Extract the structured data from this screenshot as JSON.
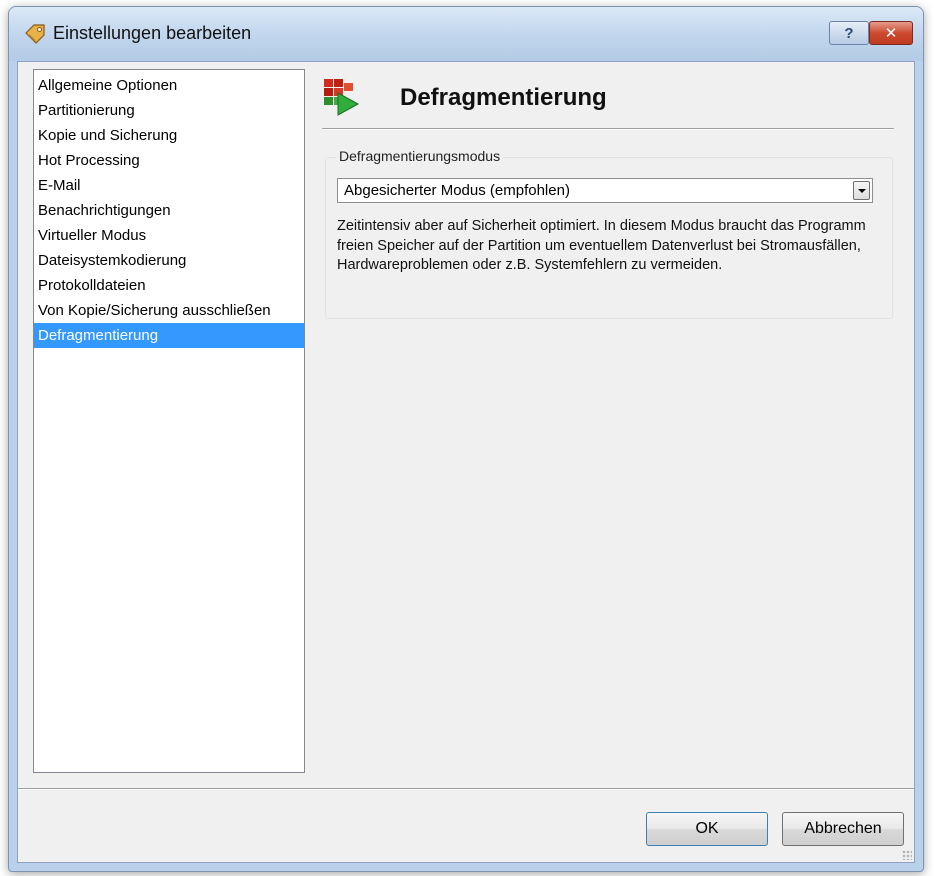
{
  "window": {
    "title": "Einstellungen bearbeiten",
    "help_label": "?",
    "close_label": "✕"
  },
  "sidebar": {
    "items": [
      {
        "label": "Allgemeine Optionen"
      },
      {
        "label": "Partitionierung"
      },
      {
        "label": "Kopie und Sicherung"
      },
      {
        "label": "Hot Processing"
      },
      {
        "label": "E-Mail"
      },
      {
        "label": "Benachrichtigungen"
      },
      {
        "label": "Virtueller Modus"
      },
      {
        "label": "Dateisystemkodierung"
      },
      {
        "label": "Protokolldateien"
      },
      {
        "label": "Von Kopie/Sicherung ausschließen"
      },
      {
        "label": "Defragmentierung"
      }
    ],
    "selected_index": 10
  },
  "page": {
    "title": "Defragmentierung",
    "icon": "defrag-blocks-icon"
  },
  "mode_group": {
    "legend": "Defragmentierungsmodus",
    "selected_value": "Abgesicherter Modus (empfohlen)",
    "description": "Zeitintensiv aber auf Sicherheit optimiert. In diesem Modus braucht das Programm freien Speicher auf der Partition um eventuellem Datenverlust bei Stromausfällen, Hardwareproblemen oder z.B. Systemfehlern zu vermeiden."
  },
  "footer": {
    "ok_label": "OK",
    "cancel_label": "Abbrechen"
  },
  "colors": {
    "selection": "#3399ff",
    "titlebar": "#c4d8ee",
    "close_button": "#c13a20"
  }
}
